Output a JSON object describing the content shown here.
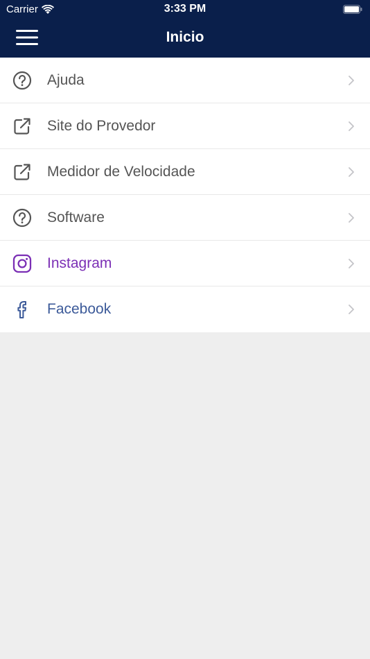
{
  "status_bar": {
    "carrier": "Carrier",
    "time": "3:33 PM"
  },
  "navbar": {
    "title": "Inicio"
  },
  "menu": {
    "items": [
      {
        "label": "Ajuda",
        "icon": "help-circle-icon"
      },
      {
        "label": "Site do Provedor",
        "icon": "external-link-icon"
      },
      {
        "label": "Medidor de Velocidade",
        "icon": "external-link-icon"
      },
      {
        "label": "Software",
        "icon": "help-circle-icon"
      },
      {
        "label": "Instagram",
        "icon": "instagram-icon"
      },
      {
        "label": "Facebook",
        "icon": "facebook-icon"
      }
    ]
  },
  "colors": {
    "header_bg": "#0a1f4b",
    "instagram": "#7b2fb5",
    "facebook": "#3c5a99",
    "background": "#eeeeee"
  }
}
